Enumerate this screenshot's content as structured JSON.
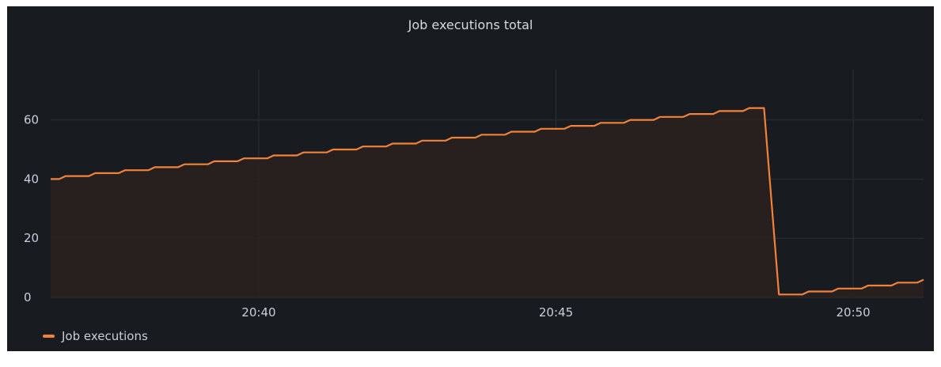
{
  "panel": {
    "title": "Job executions total"
  },
  "colors": {
    "background": "#181b1f",
    "series": "#f2823a",
    "fill": "#2b211f",
    "grid": "#2c2f36"
  },
  "chart_data": {
    "type": "area",
    "title": "Job executions total",
    "xlabel": "",
    "ylabel": "",
    "x_range": [
      "20:36:30",
      "20:51:11"
    ],
    "x_ticks": [
      "20:40",
      "20:45",
      "20:50"
    ],
    "y_ticks": [
      0,
      20,
      40,
      60
    ],
    "ylim": [
      0,
      77
    ],
    "grid": true,
    "legend": "bottom-left",
    "series": [
      {
        "name": "Job executions",
        "color": "#f2823a",
        "x": [
          "20:36:30",
          "20:36:45",
          "20:37:00",
          "20:37:15",
          "20:37:30",
          "20:37:45",
          "20:38:00",
          "20:38:15",
          "20:38:30",
          "20:38:45",
          "20:39:00",
          "20:39:15",
          "20:39:30",
          "20:39:45",
          "20:40:00",
          "20:40:15",
          "20:40:30",
          "20:40:45",
          "20:41:00",
          "20:41:15",
          "20:41:30",
          "20:41:45",
          "20:42:00",
          "20:42:15",
          "20:42:30",
          "20:42:45",
          "20:43:00",
          "20:43:15",
          "20:43:30",
          "20:43:45",
          "20:44:00",
          "20:44:15",
          "20:44:30",
          "20:44:45",
          "20:45:00",
          "20:45:15",
          "20:45:30",
          "20:45:45",
          "20:46:00",
          "20:46:15",
          "20:46:30",
          "20:46:45",
          "20:47:00",
          "20:47:15",
          "20:47:30",
          "20:47:45",
          "20:48:00",
          "20:48:15",
          "20:48:30",
          "20:48:45",
          "20:49:00",
          "20:49:15",
          "20:49:30",
          "20:49:45",
          "20:50:00",
          "20:50:15",
          "20:50:30",
          "20:50:45",
          "20:51:00",
          "20:51:11"
        ],
        "values": [
          40,
          41,
          41,
          42,
          42,
          43,
          43,
          44,
          44,
          45,
          45,
          46,
          46,
          47,
          47,
          48,
          48,
          49,
          49,
          50,
          50,
          51,
          51,
          52,
          52,
          53,
          53,
          54,
          54,
          55,
          55,
          56,
          56,
          57,
          57,
          58,
          58,
          59,
          59,
          60,
          60,
          61,
          61,
          62,
          62,
          63,
          63,
          64,
          64,
          1,
          1,
          2,
          2,
          3,
          3,
          4,
          4,
          5,
          5,
          6
        ]
      }
    ]
  }
}
